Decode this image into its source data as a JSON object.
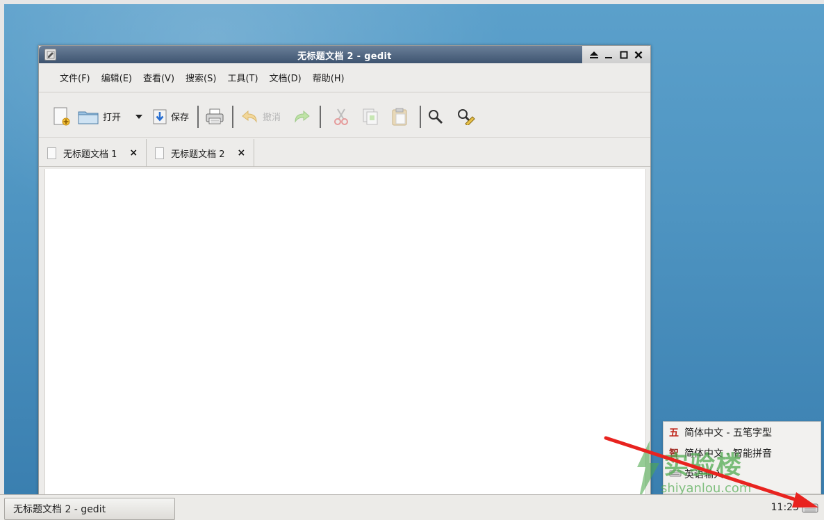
{
  "window": {
    "title": "无标题文档 2 - gedit",
    "wm_buttons": [
      "eject-icon",
      "minimize-icon",
      "maximize-icon",
      "close-icon"
    ]
  },
  "menubar": {
    "items": [
      "文件(F)",
      "编辑(E)",
      "查看(V)",
      "搜索(S)",
      "工具(T)",
      "文档(D)",
      "帮助(H)"
    ]
  },
  "toolbar": {
    "new_icon": "new-document-icon",
    "open_label": "打开",
    "save_label": "保存",
    "undo_label": "撤消",
    "icons": [
      "new-document-icon",
      "folder-open-icon",
      "dropdown-arrow-icon",
      "save-icon",
      "print-icon",
      "undo-icon",
      "redo-icon",
      "cut-icon",
      "copy-icon",
      "paste-icon",
      "search-icon",
      "replace-icon"
    ]
  },
  "tabs": [
    {
      "label": "无标题文档 1",
      "close": "×"
    },
    {
      "label": "无标题文档 2",
      "close": "×"
    }
  ],
  "taskbar": {
    "task_label": "无标题文档 2 - gedit",
    "clock": "11:25"
  },
  "im_menu": {
    "items": [
      {
        "glyph": "五",
        "label": "简体中文 - 五笔字型"
      },
      {
        "glyph": "智",
        "label": "简体中文 - 智能拼音"
      },
      {
        "glyph": "",
        "label": "英语输入"
      }
    ]
  },
  "watermark": {
    "brand": "实验楼",
    "url": "shiyanlou.com"
  },
  "colors": {
    "desktop": "#4f95c2",
    "titlebar": "#3e5470",
    "arrow": "#e8231f",
    "im_glyph": "#c0261a"
  }
}
